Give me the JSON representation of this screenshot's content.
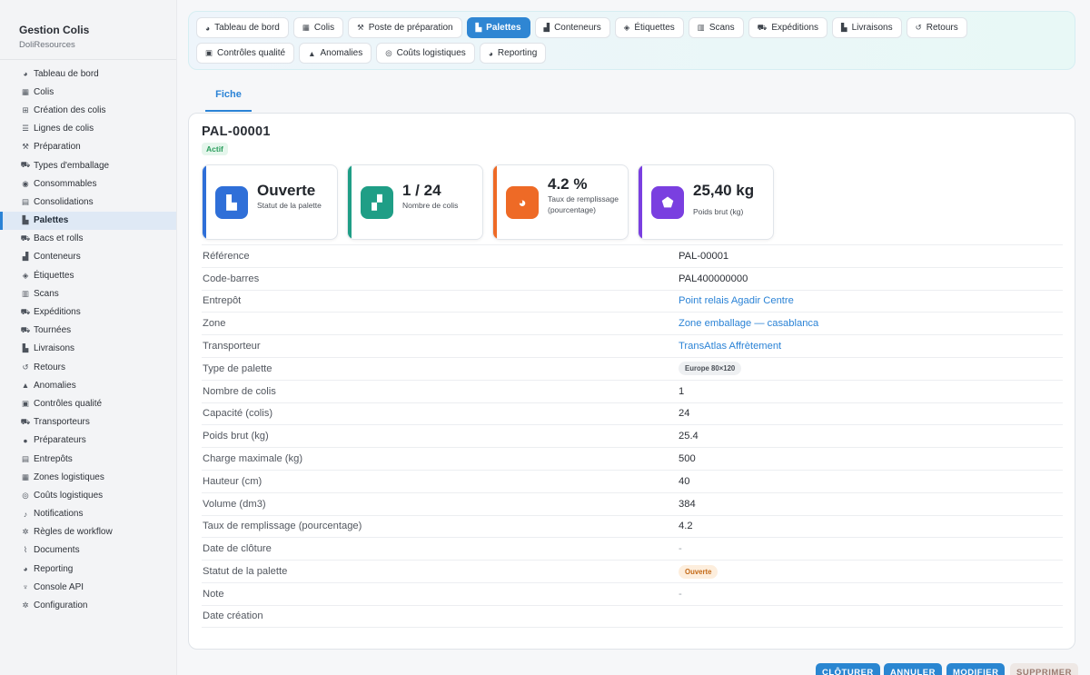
{
  "brand": {
    "title": "Gestion Colis",
    "subtitle": "DoliResources"
  },
  "sidebar": {
    "items": [
      {
        "label": "Tableau de bord",
        "icon": "dashboard-icon",
        "glyph": "◕"
      },
      {
        "label": "Colis",
        "icon": "box-icon",
        "glyph": "▦"
      },
      {
        "label": "Création des colis",
        "icon": "plus-square-icon",
        "glyph": "⊞"
      },
      {
        "label": "Lignes de colis",
        "icon": "list-icon",
        "glyph": "☰"
      },
      {
        "label": "Préparation",
        "icon": "dolly-icon",
        "glyph": "⚒"
      },
      {
        "label": "Types d'emballage",
        "icon": "truck-loading-icon",
        "glyph": "⛟"
      },
      {
        "label": "Consommables",
        "icon": "tape-icon",
        "glyph": "◉"
      },
      {
        "label": "Consolidations",
        "icon": "boxes-stacked-icon",
        "glyph": "▤"
      },
      {
        "label": "Palettes",
        "icon": "pallet-icon",
        "glyph": "▙",
        "active": true
      },
      {
        "label": "Bacs et rolls",
        "icon": "dolly-flatbed-icon",
        "glyph": "⛟"
      },
      {
        "label": "Conteneurs",
        "icon": "container-icon",
        "glyph": "▟"
      },
      {
        "label": "Étiquettes",
        "icon": "tags-icon",
        "glyph": "◈"
      },
      {
        "label": "Scans",
        "icon": "barcode-icon",
        "glyph": "▥"
      },
      {
        "label": "Expéditions",
        "icon": "shipping-fast-icon",
        "glyph": "⛟"
      },
      {
        "label": "Tournées",
        "icon": "route-truck-icon",
        "glyph": "⛟"
      },
      {
        "label": "Livraisons",
        "icon": "truck-ramp-box-icon",
        "glyph": "▙"
      },
      {
        "label": "Retours",
        "icon": "undo-icon",
        "glyph": "↺"
      },
      {
        "label": "Anomalies",
        "icon": "warning-icon",
        "glyph": "▲"
      },
      {
        "label": "Contrôles qualité",
        "icon": "clipboard-check-icon",
        "glyph": "▣"
      },
      {
        "label": "Transporteurs",
        "icon": "truck-icon",
        "glyph": "⛟"
      },
      {
        "label": "Préparateurs",
        "icon": "users-gear-icon",
        "glyph": "●"
      },
      {
        "label": "Entrepôts",
        "icon": "warehouse-icon",
        "glyph": "▤"
      },
      {
        "label": "Zones logistiques",
        "icon": "grid-icon",
        "glyph": "▦"
      },
      {
        "label": "Coûts logistiques",
        "icon": "coins-icon",
        "glyph": "◎"
      },
      {
        "label": "Notifications",
        "icon": "bell-icon",
        "glyph": "♪"
      },
      {
        "label": "Règles de workflow",
        "icon": "cogs-icon",
        "glyph": "✲"
      },
      {
        "label": "Documents",
        "icon": "paperclip-icon",
        "glyph": "⌇"
      },
      {
        "label": "Reporting",
        "icon": "chart-pie-icon",
        "glyph": "◕"
      },
      {
        "label": "Console API",
        "icon": "plug-icon",
        "glyph": "♆"
      },
      {
        "label": "Configuration",
        "icon": "gear-icon",
        "glyph": "✲"
      }
    ]
  },
  "tabs": {
    "row1": [
      {
        "label": "Tableau de bord",
        "icon": "dashboard-icon",
        "glyph": "◕"
      },
      {
        "label": "Colis",
        "icon": "box-icon",
        "glyph": "▦"
      },
      {
        "label": "Poste de préparation",
        "icon": "dolly-icon",
        "glyph": "⚒"
      },
      {
        "label": "Palettes",
        "icon": "pallet-icon",
        "glyph": "▙",
        "active": true
      },
      {
        "label": "Conteneurs",
        "icon": "container-icon",
        "glyph": "▟"
      },
      {
        "label": "Étiquettes",
        "icon": "tags-icon",
        "glyph": "◈"
      },
      {
        "label": "Scans",
        "icon": "barcode-icon",
        "glyph": "▥"
      },
      {
        "label": "Expéditions",
        "icon": "shipping-fast-icon",
        "glyph": "⛟"
      },
      {
        "label": "Livraisons",
        "icon": "truck-ramp-box-icon",
        "glyph": "▙"
      },
      {
        "label": "Retours",
        "icon": "undo-icon",
        "glyph": "↺"
      }
    ],
    "row2": [
      {
        "label": "Contrôles qualité",
        "icon": "clipboard-check-icon",
        "glyph": "▣"
      },
      {
        "label": "Anomalies",
        "icon": "warning-icon",
        "glyph": "▲"
      },
      {
        "label": "Coûts logistiques",
        "icon": "coins-icon",
        "glyph": "◎"
      },
      {
        "label": "Reporting",
        "icon": "chart-pie-icon",
        "glyph": "◕"
      }
    ]
  },
  "subtab": {
    "label": "Fiche"
  },
  "record": {
    "title": "PAL-00001",
    "status_badge": "Actif"
  },
  "kpis": [
    {
      "value": "Ouverte",
      "label": "Statut de la palette",
      "color": "#2f6fd8",
      "icon": "pallet-icon",
      "glyph": "▙"
    },
    {
      "value": "1 / 24",
      "label": "Nombre de colis",
      "color": "#1f9e86",
      "icon": "boxes-icon",
      "glyph": "▞"
    },
    {
      "value": "4.2 %",
      "label": "Taux de remplissage (pourcentage)",
      "color": "#ee6a26",
      "icon": "chart-pie-icon",
      "glyph": "◕"
    },
    {
      "value": "25,40 kg",
      "label": "Poids brut (kg)",
      "color": "#7a3fe0",
      "icon": "weight-icon",
      "glyph": "⬟"
    }
  ],
  "details": [
    {
      "label": "Référence",
      "value": "PAL-00001",
      "type": "text"
    },
    {
      "label": "Code-barres",
      "value": "PAL400000000",
      "type": "text"
    },
    {
      "label": "Entrepôt",
      "value": "Point relais Agadir Centre",
      "type": "link"
    },
    {
      "label": "Zone",
      "value": "Zone emballage — casablanca",
      "type": "link"
    },
    {
      "label": "Transporteur",
      "value": "TransAtlas Affrètement",
      "type": "link"
    },
    {
      "label": "Type de palette",
      "value": "Europe 80×120",
      "type": "pill-grey"
    },
    {
      "label": "Nombre de colis",
      "value": "1",
      "type": "text"
    },
    {
      "label": "Capacité (colis)",
      "value": "24",
      "type": "text"
    },
    {
      "label": "Poids brut (kg)",
      "value": "25.4",
      "type": "text"
    },
    {
      "label": "Charge maximale (kg)",
      "value": "500",
      "type": "text"
    },
    {
      "label": "Hauteur (cm)",
      "value": "40",
      "type": "text"
    },
    {
      "label": "Volume (dm3)",
      "value": "384",
      "type": "text"
    },
    {
      "label": "Taux de remplissage (pourcentage)",
      "value": "4.2",
      "type": "text"
    },
    {
      "label": "Date de clôture",
      "value": "-",
      "type": "muted"
    },
    {
      "label": "Statut de la palette",
      "value": "Ouverte",
      "type": "pill-orange"
    },
    {
      "label": "Note",
      "value": "-",
      "type": "muted"
    },
    {
      "label": "Date création",
      "value": "",
      "type": "text"
    }
  ],
  "actions": [
    {
      "label": "CLÔTURER",
      "style": "primary"
    },
    {
      "label": "ANNULER",
      "style": "primary"
    },
    {
      "label": "MODIFIER",
      "style": "primary"
    },
    {
      "label": "SUPPRIMER",
      "style": "danger"
    }
  ]
}
